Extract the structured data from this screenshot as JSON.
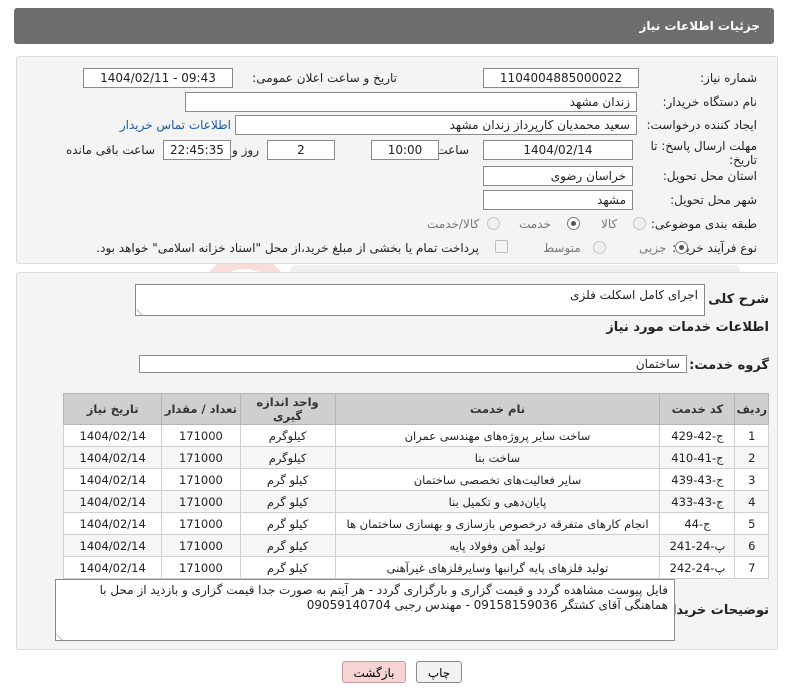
{
  "header": {
    "title": "جزئیات اطلاعات نیاز"
  },
  "form": {
    "need_number_label": "شماره نیاز:",
    "need_number": "1104004885000022",
    "announce_label": "تاریخ و ساعت اعلان عمومی:",
    "announce_value": "1404/02/11 - 09:43",
    "buyer_org_label": "نام دستگاه خریدار:",
    "buyer_org": "زندان مشهد",
    "creator_label": "ایجاد کننده درخواست:",
    "creator": "سعید محمدیان کارپرداز زندان مشهد",
    "contact_link": "اطلاعات تماس خریدار",
    "deadline_label_1": "مهلت ارسال پاسخ: تا",
    "deadline_label_2": "تاریخ:",
    "deadline_date": "1404/02/14",
    "time_label": "ساعت",
    "deadline_time": "10:00",
    "days_value": "2",
    "days_label": "روز و",
    "remaining_time": "22:45:35",
    "remaining_label": "ساعت باقی مانده",
    "province_label": "استان محل تحویل:",
    "province": "خراسان رضوی",
    "city_label": "شهر محل تحویل:",
    "city": "مشهد",
    "category_label": "طبقه بندی موضوعی:",
    "category_options": [
      "کالا",
      "خدمت",
      "کالا/خدمت"
    ],
    "category_selected": "خدمت",
    "process_label": "نوع فرآیند خرید :",
    "process_options": [
      "جزیی",
      "متوسط"
    ],
    "process_selected": "جزیی",
    "payment_note": "پرداخت تمام یا بخشی از مبلغ خرید،از محل \"اسناد خزانه اسلامی\" خواهد بود."
  },
  "details": {
    "summary_label": "شرح کلی نیاز:",
    "summary_value": "اجرای کامل اسکلت فلزی",
    "services_title": "اطلاعات خدمات مورد نیاز",
    "service_group_label": "گروه خدمت:",
    "service_group": "ساختمان",
    "table": {
      "headers": [
        "ردیف",
        "کد خدمت",
        "نام خدمت",
        "واحد اندازه گیری",
        "تعداد / مقدار",
        "تاریخ نیاز"
      ],
      "rows": [
        [
          "1",
          "ج-42-429",
          "ساخت سایر پروژه‌های مهندسی عمران",
          "کیلوگرم",
          "171000",
          "1404/02/14"
        ],
        [
          "2",
          "ج-41-410",
          "ساخت بنا",
          "کیلوگرم",
          "171000",
          "1404/02/14"
        ],
        [
          "3",
          "ج-43-439",
          "سایر فعالیت‌های تخصصی ساختمان",
          "کیلو گرم",
          "171000",
          "1404/02/14"
        ],
        [
          "4",
          "ج-43-433",
          "پایان‌دهی و تکمیل بنا",
          "کیلو گرم",
          "171000",
          "1404/02/14"
        ],
        [
          "5",
          "ج-44",
          "انجام کارهای متفرقه درخصوص بازسازی و بهسازی ساختمان ها",
          "کیلو گرم",
          "171000",
          "1404/02/14"
        ],
        [
          "6",
          "پ-24-241",
          "تولید آهن وفولاد پایه",
          "کیلو گرم",
          "171000",
          "1404/02/14"
        ],
        [
          "7",
          "پ-24-242",
          "تولید فلزهای پایه گرانبها وسایرفلزهای غیرآهنی",
          "کیلو گرم",
          "171000",
          "1404/02/14"
        ]
      ]
    },
    "buyer_notes_label": "توضیحات خریدار:",
    "buyer_notes": "فایل پیوست مشاهده گردد و قیمت گزاری و بارگزاری گردد - هر آیتم به صورت جدا قیمت گزاری و بازدید از محل با هماهنگی آقای کشتگر  09158159036  -   مهندس رجبی 09059140704"
  },
  "buttons": {
    "print": "چاپ",
    "back": "بازگشت"
  },
  "colors": {
    "header_bg": "#6e6e6e",
    "back_button_bg": "#f7d4d4",
    "link": "#1a5aa6"
  }
}
